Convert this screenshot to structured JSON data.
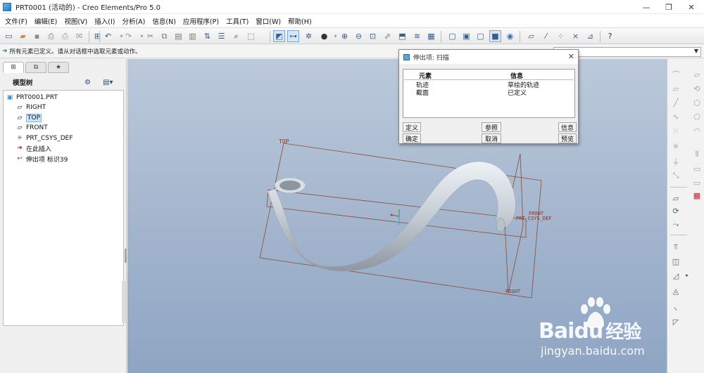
{
  "window": {
    "title": "PRT0001 (活动的) - Creo Elements/Pro 5.0",
    "minimize_glyph": "—",
    "maximize_glyph": "❐",
    "close_glyph": "✕"
  },
  "menu": [
    "文件(F)",
    "编辑(E)",
    "视图(V)",
    "插入(I)",
    "分析(A)",
    "信息(N)",
    "应用程序(P)",
    "工具(T)",
    "窗口(W)",
    "帮助(H)"
  ],
  "status": {
    "message": "所有元素已定义。请从对话框中选取元素或动作。"
  },
  "model_tree": {
    "header": "模型树",
    "items": [
      {
        "label": "PRT0001.PRT",
        "icon": "part-icon",
        "glyph": "▣"
      },
      {
        "label": "RIGHT",
        "icon": "datum-plane-icon",
        "glyph": "▱"
      },
      {
        "label": "TOP",
        "icon": "datum-plane-icon",
        "glyph": "▱",
        "selected": true
      },
      {
        "label": "FRONT",
        "icon": "datum-plane-icon",
        "glyph": "▱"
      },
      {
        "label": "PRT_CSYS_DEF",
        "icon": "csys-icon",
        "glyph": "✳"
      },
      {
        "label": "在此插入",
        "icon": "insert-here-icon",
        "glyph": "➔"
      },
      {
        "label": "伸出项 标识39",
        "icon": "sweep-feature-icon",
        "glyph": "↩"
      }
    ]
  },
  "viewport": {
    "labels": {
      "top": "TOP",
      "front": "FRONT",
      "csys": "PRT_CSYS_DEF",
      "right": "RIGHT"
    }
  },
  "dialog": {
    "title": "伸出项: 扫描",
    "columns": [
      "元素",
      "信息"
    ],
    "rows": [
      {
        "element": "轨迹",
        "info": "草绘的轨迹"
      },
      {
        "element": "截面",
        "info": "已定义"
      }
    ],
    "buttons": {
      "define": "定义",
      "refs": "参照",
      "info": "信息",
      "ok": "确定",
      "cancel": "取消",
      "preview": "预览"
    }
  },
  "watermark": {
    "brand": "Bai",
    "brand2": "du",
    "brand3": "经验",
    "url": "jingyan.baidu.com"
  },
  "colors": {
    "viewport_top": "#bcc9db",
    "viewport_bottom": "#8ea5c3",
    "datum_line": "#8b4a3a",
    "tree_selection": "#cde3f7"
  }
}
